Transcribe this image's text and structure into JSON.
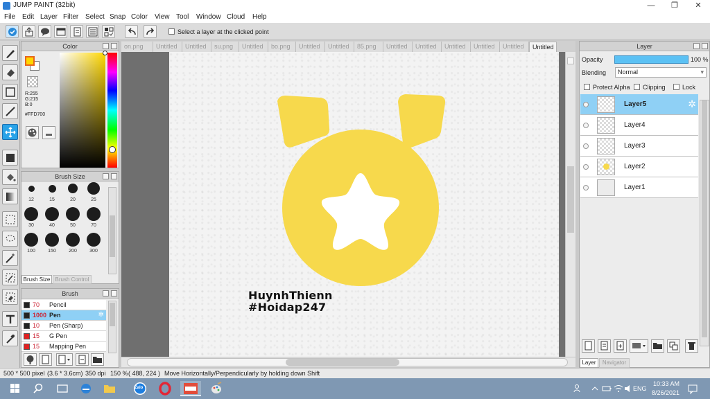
{
  "window": {
    "title": "JUMP PAINT (32bit)",
    "minimize": "—",
    "maximize": "❐",
    "close": "✕"
  },
  "menu": [
    "File",
    "Edit",
    "Layer",
    "Filter",
    "Select",
    "Snap",
    "Color",
    "View",
    "Tool",
    "Window",
    "Cloud",
    "Help"
  ],
  "toolbar": {
    "select_layer_label": "Select a layer at the clicked point"
  },
  "color_panel": {
    "title": "Color",
    "r": "R:255",
    "g": "G:215",
    "b": "B:0",
    "hex": "#FFD700",
    "current_color": "#ffd700"
  },
  "brush_size_panel": {
    "title": "Brush Size",
    "sizes": [
      "12",
      "15",
      "20",
      "25",
      "30",
      "40",
      "50",
      "70",
      "100",
      "150",
      "200",
      "300"
    ],
    "tab_active": "Brush Size",
    "tab_inactive": "Brush Control"
  },
  "brush_panel": {
    "title": "Brush",
    "items": [
      {
        "size": "70",
        "name": "Pencil",
        "color": "#222222"
      },
      {
        "size": "1000",
        "name": "Pen",
        "color": "#222222"
      },
      {
        "size": "10",
        "name": "Pen (Sharp)",
        "color": "#222222"
      },
      {
        "size": "15",
        "name": "G Pen",
        "color": "#e02222"
      },
      {
        "size": "15",
        "name": "Mapping Pen",
        "color": "#e02222"
      }
    ]
  },
  "document_tabs": [
    "on.png",
    "Untitled",
    "Untitled",
    "su.png",
    "Untitled",
    "bo.png",
    "Untitled",
    "Untitled",
    "85.png",
    "Untitled",
    "Untitled",
    "Untitled",
    "Untitled",
    "Untitled",
    "Untitled"
  ],
  "canvas": {
    "caption_line1": "HuynhThienn",
    "caption_line2": "#Hoidap247",
    "shape_color": "#f7d94c"
  },
  "layer_panel": {
    "title": "Layer",
    "opacity_label": "Opacity",
    "opacity_value": "100 %",
    "blending_label": "Blending",
    "blending_value": "Normal",
    "protect_alpha": "Protect Alpha",
    "clipping": "Clipping",
    "lock": "Lock",
    "layers": [
      "Layer5",
      "Layer4",
      "Layer3",
      "Layer2",
      "Layer1"
    ],
    "tab_active": "Layer",
    "tab_inactive": "Navigator"
  },
  "status": {
    "size": "500 * 500 pixel",
    "cm": "(3.6 * 3.6cm)",
    "dpi": "350 dpi",
    "zoom": "150 %",
    "coords": "( 488, 224 )",
    "hint": "Move Horizontally/Perpendicularly by holding down Shift"
  },
  "taskbar": {
    "time": "10:33 AM",
    "date": "8/26/2021",
    "lang": "ENG",
    "zalo": "Zalo"
  }
}
